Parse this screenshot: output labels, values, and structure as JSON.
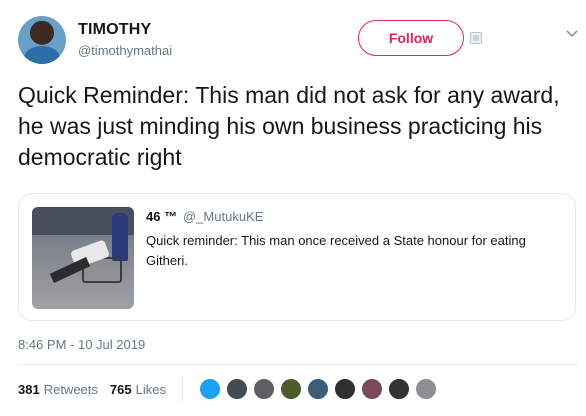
{
  "author": {
    "name": "TIMOTHY",
    "handle": "@timothymathai"
  },
  "follow_label": "Follow",
  "tweet_text": "Quick Reminder: This man did not ask for any award, he was just minding his own business practicing his democratic right",
  "quoted": {
    "name": "46 ™",
    "handle": "@_MutukuKE",
    "text": "Quick reminder: This man once received a State honour for eating Githeri."
  },
  "timestamp": "8:46 PM - 10 Jul 2019",
  "stats": {
    "retweets_count": "381",
    "retweets_label": "Retweets",
    "likes_count": "765",
    "likes_label": "Likes"
  },
  "liker_colors": [
    "#1da1f2",
    "#444b52",
    "#5c5f63",
    "#4d5a2f",
    "#3d5e7a",
    "#2f2f2f",
    "#7a4a5c",
    "#333333",
    "#8c8f91"
  ],
  "colors": {
    "follow_accent": "#e0245e",
    "secondary_text": "#657786"
  }
}
